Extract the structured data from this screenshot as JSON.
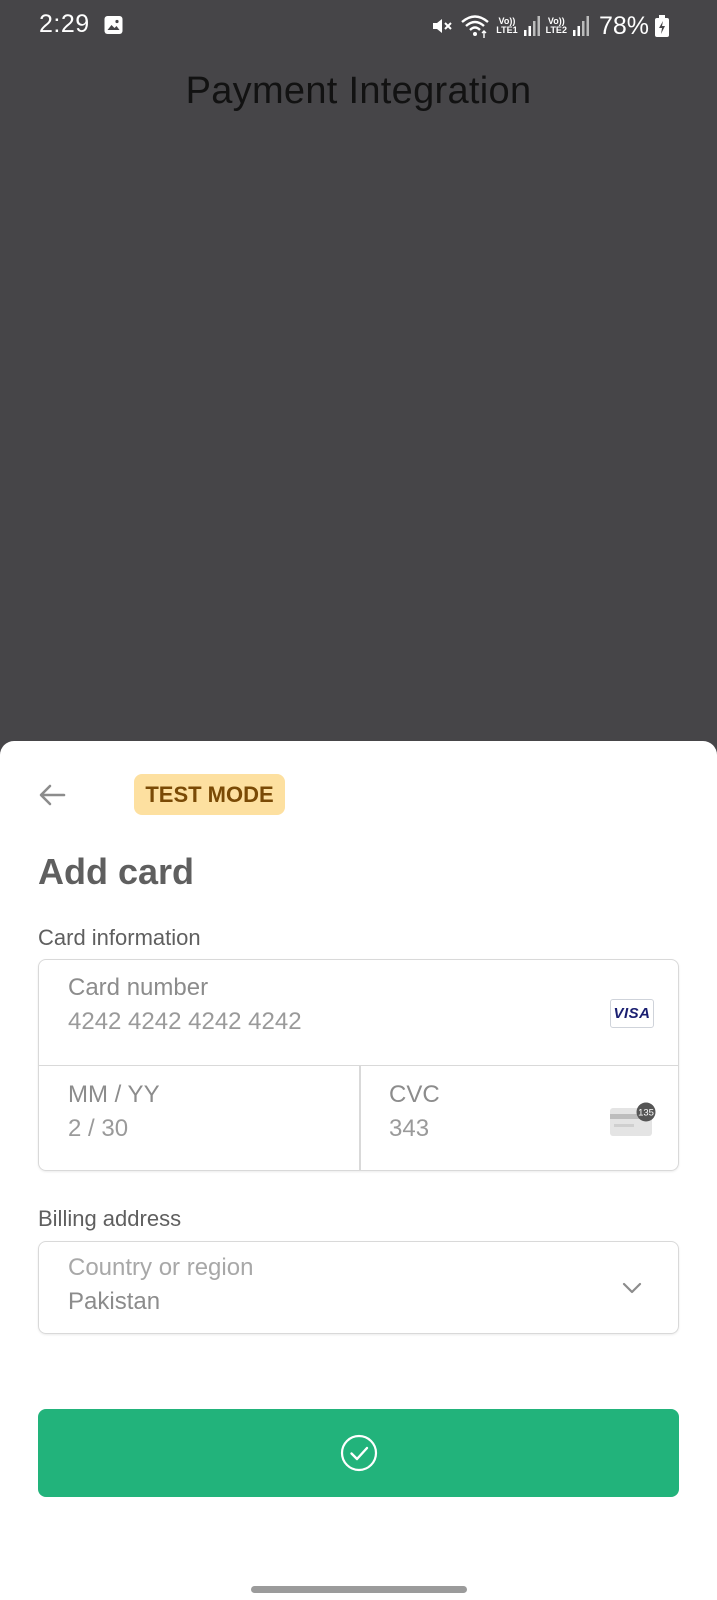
{
  "status_bar": {
    "time": "2:29",
    "battery": "78%",
    "sim1_tag": "Vo))",
    "sim1_net": "LTE1",
    "sim2_tag": "Vo))",
    "sim2_net": "LTE2",
    "icons": [
      "gallery-icon",
      "mute-icon",
      "wifi-icon",
      "signal-icon",
      "battery-charging-icon"
    ]
  },
  "app": {
    "title": "Payment Integration"
  },
  "sheet": {
    "badge": "TEST MODE",
    "title": "Add card",
    "card_section_label": "Card information",
    "card_number": {
      "label": "Card number",
      "value": "4242 4242 4242 4242",
      "brand": "VISA"
    },
    "expiry": {
      "label": "MM / YY",
      "value": "2 / 30"
    },
    "cvc": {
      "label": "CVC",
      "value": "343",
      "hint": "135"
    },
    "billing_section_label": "Billing address",
    "country": {
      "label": "Country or region",
      "value": "Pakistan"
    },
    "confirm_icon": "checkmark-circle-icon"
  },
  "colors": {
    "backdrop": "#464548",
    "accent_green": "#22b37b",
    "badge_bg": "#fde0a0",
    "badge_text": "#7a4a05"
  }
}
